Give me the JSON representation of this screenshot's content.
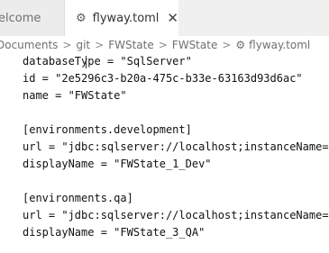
{
  "tabs": [
    {
      "label": "elcome"
    },
    {
      "label": "flyway.toml",
      "close_glyph": "✕"
    }
  ],
  "breadcrumb": {
    "items": [
      "Documents",
      "git",
      "FWState",
      "FWState",
      "flyway.toml"
    ],
    "separator": ">"
  },
  "editor": {
    "lines": [
      "databaseType = \"SqlServer\"",
      "id = \"2e5296c3-b20a-475c-b33e-63163d93d6ac\"",
      "name = \"FWState\"",
      "",
      "[environments.development]",
      "url = \"jdbc:sqlserver://localhost;instanceName=",
      "displayName = \"FWState_1_Dev\"",
      "",
      "[environments.qa]",
      "url = \"jdbc:sqlserver://localhost;instanceName=",
      "displayName = \"FWState_3_QA\""
    ]
  },
  "icons": {
    "tab_file_icon": "gear-icon",
    "breadcrumb_file_icon": "gear-icon",
    "tab_close_icon": "close-icon"
  }
}
